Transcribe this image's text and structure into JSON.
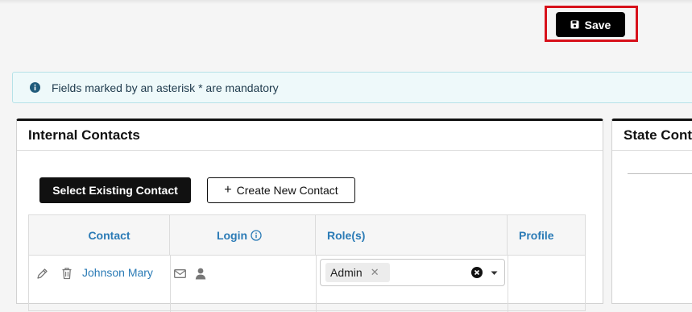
{
  "toolbar": {
    "save_label": "Save"
  },
  "info_banner": {
    "message": "Fields marked by an asterisk * are mandatory"
  },
  "internal_contacts": {
    "title": "Internal Contacts",
    "select_existing_label": "Select Existing Contact",
    "create_new_label": "Create New Contact",
    "columns": {
      "contact": "Contact",
      "login": "Login",
      "roles": "Role(s)",
      "profile": "Profile"
    },
    "rows": [
      {
        "name": "Johnson Mary",
        "roles": [
          "Admin"
        ],
        "profile": ""
      }
    ]
  },
  "state_contacts": {
    "title": "State Cont"
  },
  "icons": {
    "save": "floppy-disk-icon",
    "info": "info-circle-icon",
    "edit": "pencil-icon",
    "delete": "trash-icon",
    "email": "envelope-icon",
    "user": "person-icon",
    "clear": "clear-circle-icon",
    "dropdown": "caret-down-icon"
  },
  "colors": {
    "link": "#2b7bb6",
    "highlight": "#d7111b",
    "primary_button": "#111111",
    "info_bg": "#eef9fa"
  }
}
